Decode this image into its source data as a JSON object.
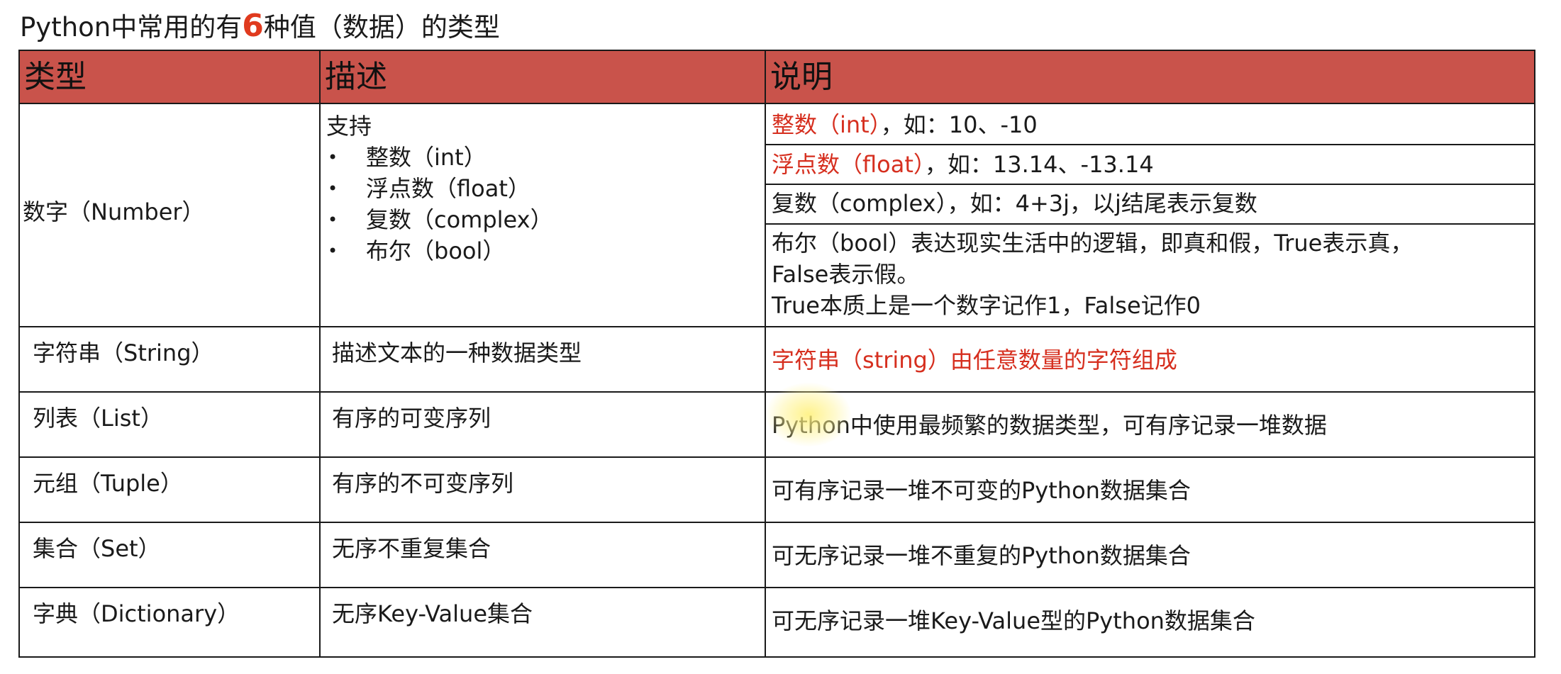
{
  "title": {
    "prefix": "Python中常用的有",
    "number": "6",
    "suffix": "种值（数据）的类型"
  },
  "headers": {
    "type": "类型",
    "desc": "描述",
    "note": "说明"
  },
  "number_row": {
    "type": "数字（Number）",
    "desc_intro": "支持",
    "desc_items": [
      "整数（int）",
      "浮点数（float）",
      "复数（complex）",
      "布尔（bool）"
    ],
    "notes": {
      "int_red": "整数（int）",
      "int_rest": "，如：10、-10",
      "float_red": "浮点数（float）",
      "float_rest": "，如：13.14、-13.14",
      "complex": "复数（complex），如：4+3j，以j结尾表示复数",
      "bool_line1": "布尔（bool）表达现实生活中的逻辑，即真和假，True表示真，",
      "bool_line2": "False表示假。",
      "bool_line3": "True本质上是一个数字记作1，False记作0"
    }
  },
  "rows": [
    {
      "type": "字符串（String）",
      "desc": "描述文本的一种数据类型",
      "note": "字符串（string）由任意数量的字符组成"
    },
    {
      "type": "列表（List）",
      "desc": "有序的可变序列",
      "note": "Python中使用最频繁的数据类型，可有序记录一堆数据"
    },
    {
      "type": "元组（Tuple）",
      "desc": "有序的不可变序列",
      "note": "可有序记录一堆不可变的Python数据集合"
    },
    {
      "type": "集合（Set）",
      "desc": "无序不重复集合",
      "note": "可无序记录一堆不重复的Python数据集合"
    },
    {
      "type": "字典（Dictionary）",
      "desc": "无序Key-Value集合",
      "note": "可无序记录一堆Key-Value型的Python数据集合"
    }
  ],
  "colors": {
    "header_bg": "#c9534b",
    "accent_red": "#d62f1f",
    "title_number": "#e03a1e"
  }
}
